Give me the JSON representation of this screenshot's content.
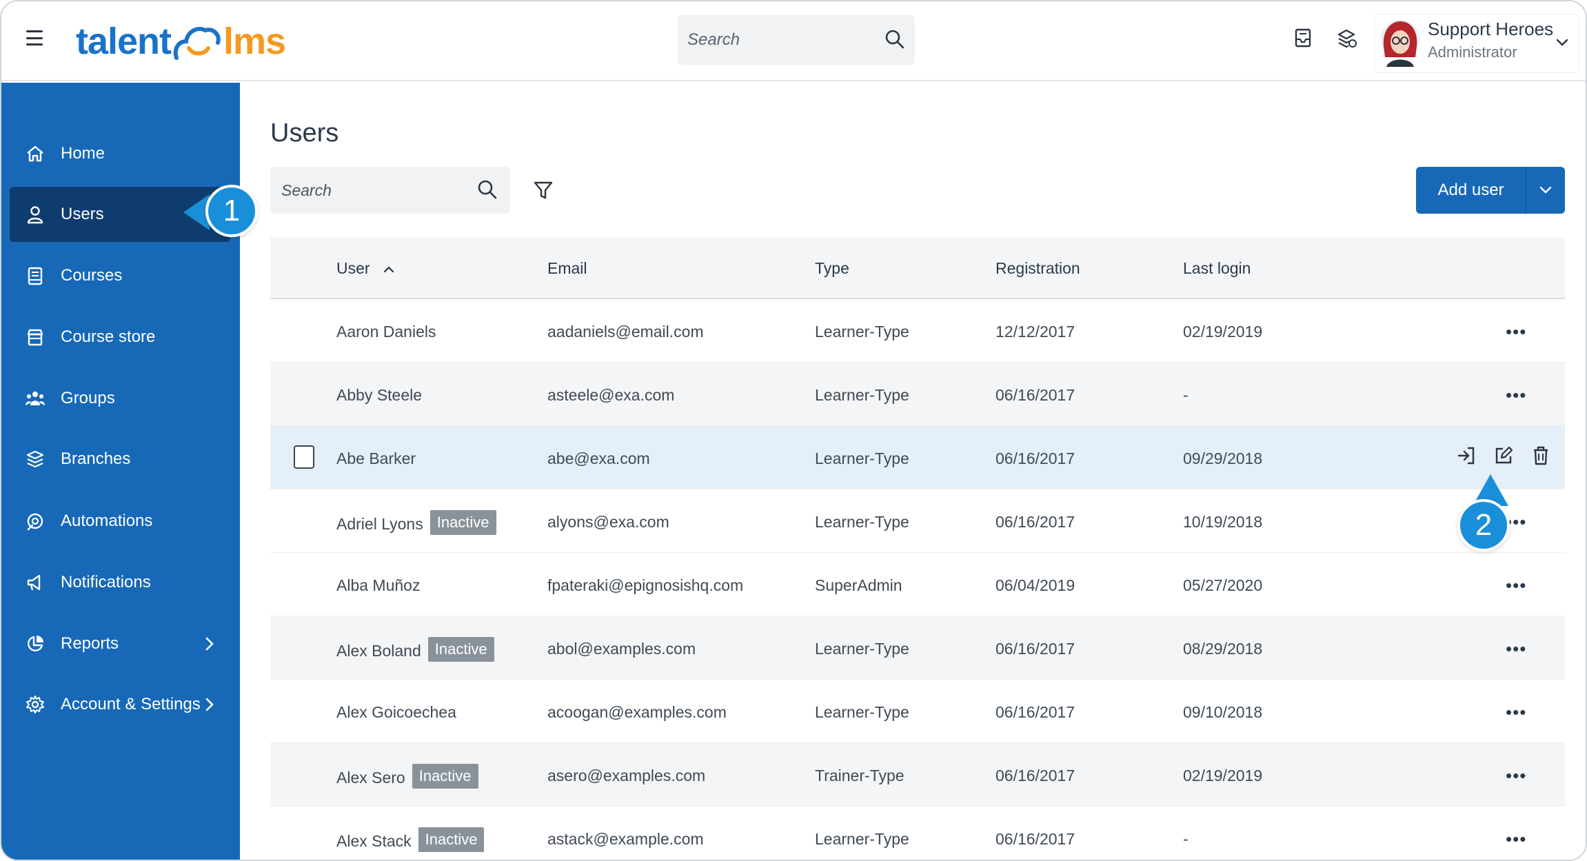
{
  "app": {
    "logo_part1": "talent",
    "logo_part2": "lms",
    "search_placeholder": "Search",
    "user_name": "Support Heroes",
    "user_role": "Administrator",
    "brand_color": "#1769b8",
    "accent_color": "#f39a1f"
  },
  "sidebar": {
    "items": [
      {
        "label": "Home",
        "icon": "home-icon"
      },
      {
        "label": "Users",
        "icon": "user-icon"
      },
      {
        "label": "Courses",
        "icon": "book-icon"
      },
      {
        "label": "Course store",
        "icon": "store-icon"
      },
      {
        "label": "Groups",
        "icon": "groups-icon"
      },
      {
        "label": "Branches",
        "icon": "layers-icon"
      },
      {
        "label": "Automations",
        "icon": "automation-icon"
      },
      {
        "label": "Notifications",
        "icon": "megaphone-icon"
      },
      {
        "label": "Reports",
        "icon": "pie-chart-icon"
      },
      {
        "label": "Account & Settings",
        "icon": "gear-icon"
      }
    ]
  },
  "callouts": {
    "one": "1",
    "two": "2"
  },
  "main": {
    "title": "Users",
    "search_placeholder": "Search",
    "add_user_label": "Add user"
  },
  "table": {
    "columns": [
      "User",
      "Email",
      "Type",
      "Registration",
      "Last login"
    ],
    "inactive_label": "Inactive",
    "rows": [
      {
        "user": "Aaron Daniels",
        "email": "aadaniels@email.com",
        "type": "Learner-Type",
        "registration": "12/12/2017",
        "last_login": "02/19/2019",
        "inactive": false
      },
      {
        "user": "Abby Steele",
        "email": "asteele@exa.com",
        "type": "Learner-Type",
        "registration": "06/16/2017",
        "last_login": "-",
        "inactive": false
      },
      {
        "user": "Abe Barker",
        "email": "abe@exa.com",
        "type": "Learner-Type",
        "registration": "06/16/2017",
        "last_login": "09/29/2018",
        "inactive": false
      },
      {
        "user": "Adriel Lyons",
        "email": "alyons@exa.com",
        "type": "Learner-Type",
        "registration": "06/16/2017",
        "last_login": "10/19/2018",
        "inactive": true
      },
      {
        "user": "Alba Muñoz",
        "email": "fpateraki@epignosishq.com",
        "type": "SuperAdmin",
        "registration": "06/04/2019",
        "last_login": "05/27/2020",
        "inactive": false
      },
      {
        "user": "Alex Boland",
        "email": "abol@examples.com",
        "type": "Learner-Type",
        "registration": "06/16/2017",
        "last_login": "08/29/2018",
        "inactive": true
      },
      {
        "user": "Alex Goicoechea",
        "email": "acoogan@examples.com",
        "type": "Learner-Type",
        "registration": "06/16/2017",
        "last_login": "09/10/2018",
        "inactive": false
      },
      {
        "user": "Alex Sero",
        "email": "asero@examples.com",
        "type": "Trainer-Type",
        "registration": "06/16/2017",
        "last_login": "02/19/2019",
        "inactive": true
      },
      {
        "user": "Alex Stack",
        "email": "astack@example.com",
        "type": "Learner-Type",
        "registration": "06/16/2017",
        "last_login": "-",
        "inactive": true
      }
    ]
  }
}
